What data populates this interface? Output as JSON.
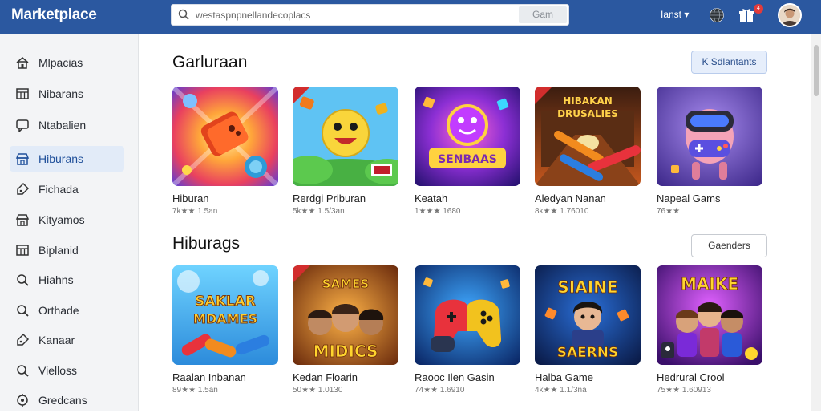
{
  "header": {
    "logo": "Marketplace",
    "search_value": "westaspnpnellandecoplacs",
    "search_button": "Gam",
    "top_link": "Ianst ▾",
    "badge": "4"
  },
  "sidebar": {
    "items": [
      {
        "label": "Mlpacias",
        "icon": "home-icon"
      },
      {
        "label": "Nibarans",
        "icon": "grid-icon"
      },
      {
        "label": "Ntabalien",
        "icon": "chat-icon"
      },
      {
        "label": "Hiburans",
        "icon": "store-icon",
        "active": true
      },
      {
        "label": "Fichada",
        "icon": "tag-icon"
      },
      {
        "label": "Kityamos",
        "icon": "store-icon"
      },
      {
        "label": "Biplanid",
        "icon": "grid-icon"
      },
      {
        "label": "Hiahns",
        "icon": "search-icon"
      },
      {
        "label": "Orthade",
        "icon": "search-icon"
      },
      {
        "label": "Kanaar",
        "icon": "tag-icon"
      },
      {
        "label": "Vielloss",
        "icon": "search-icon"
      },
      {
        "label": "Gredcans",
        "icon": "settings-icon"
      }
    ]
  },
  "sections": [
    {
      "title": "Garluraan",
      "button": "K Sdlantants",
      "cards": [
        {
          "title": "Hiburan",
          "meta": "7k★★ 1.5an",
          "theme": "a"
        },
        {
          "title": "Rerdgi Priburan",
          "meta": "5k★★ 1.5/3an",
          "theme": "b"
        },
        {
          "title": "Keatah",
          "meta": "1★★★ 1680",
          "theme": "c"
        },
        {
          "title": "Aledyan Nanan",
          "meta": "8k★★ 1.76010",
          "theme": "d"
        },
        {
          "title": "Napeal Gams",
          "meta": "76★★",
          "theme": "e"
        }
      ]
    },
    {
      "title": "Hiburags",
      "button": "Gaenders",
      "cards": [
        {
          "title": "Raalan Inbanan",
          "meta": "89★★ 1.5an",
          "theme": "f"
        },
        {
          "title": "Kedan Floarin",
          "meta": "50★★ 1.0130",
          "theme": "g"
        },
        {
          "title": "Raooc Ilen Gasin",
          "meta": "74★★ 1.6910",
          "theme": "h"
        },
        {
          "title": "Halba Game",
          "meta": "4k★★ 1.1/3na",
          "theme": "i"
        },
        {
          "title": "Hedrural Crool",
          "meta": "75★★ 1.60913",
          "theme": "j"
        }
      ]
    }
  ],
  "art_text": {
    "c": "SENBAAS",
    "d": "HIBAKAN DRUSALIES",
    "f": "SAKLAR MDAMES",
    "g": "SAMES MIDICS",
    "i": "SIAINE SAERNS",
    "j": "MAIKE"
  },
  "colors": {
    "topbar": "#2b58a0",
    "accent": "#1f4f9a"
  }
}
